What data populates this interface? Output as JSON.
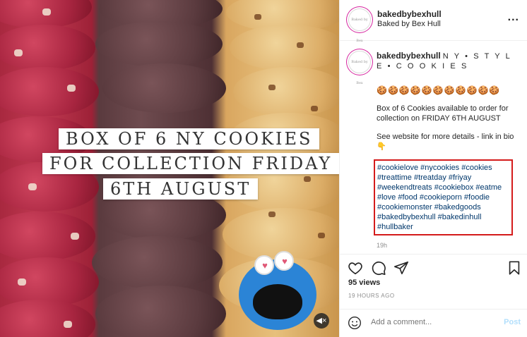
{
  "media": {
    "overlay_lines": [
      "BOX OF 6 NY COOKIES",
      "FOR COLLECTION FRIDAY",
      "6TH AUGUST"
    ]
  },
  "header": {
    "avatar_text": "Baked by Bex",
    "username": "bakedbybexhull",
    "location": "Baked by Bex Hull",
    "more_icon": "..."
  },
  "caption": {
    "username": "bakedbybexhull",
    "title": "N Y • S T Y L E • C O O K I E S",
    "emojis": "🍪🍪🍪🍪🍪🍪🍪🍪🍪🍪🍪",
    "line1": "Box of 6 Cookies available to order for collection on FRIDAY 6TH AUGUST",
    "line2": "See website for more details - link in bio 👇",
    "hashtags": "#cookielove #nycookies #cookies #treattime #treatday #friyay #weekendtreats #cookiebox #eatme #love #food #cookieporn #foodie #cookiemonster #bakedgoods #bakedbybexhull #bakedinhull #hullbaker",
    "time": "19h"
  },
  "stats": {
    "views": "95 views",
    "ago": "19 HOURS AGO"
  },
  "comment": {
    "placeholder": "Add a comment...",
    "post_label": "Post"
  },
  "colors": {
    "accent": "#0095f6",
    "highlight_box": "#d41b1b",
    "hashtag": "#00376b"
  }
}
